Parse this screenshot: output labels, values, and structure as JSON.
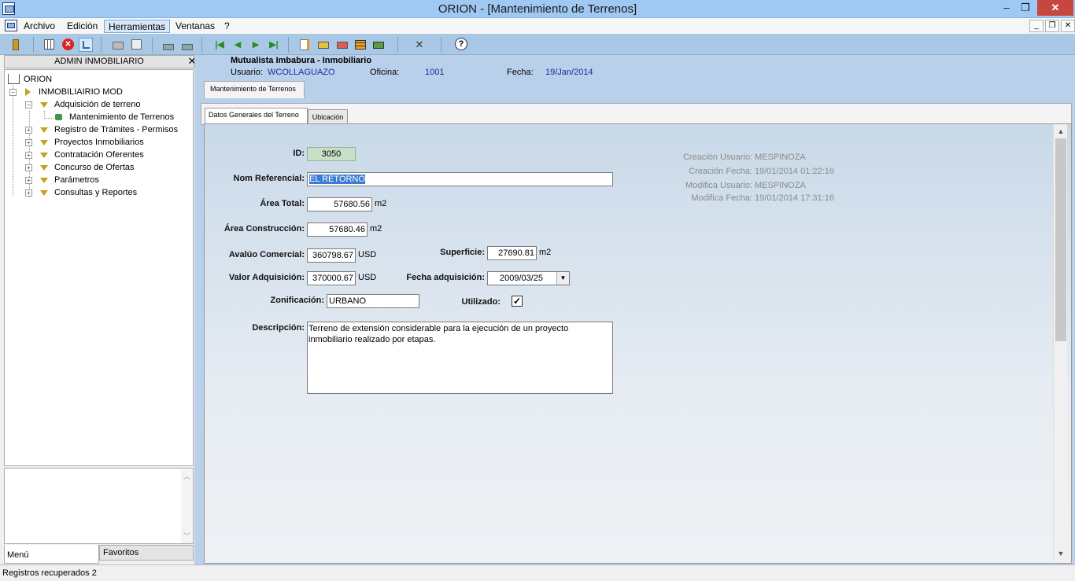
{
  "window": {
    "title": "ORION - [Mantenimiento de Terrenos]",
    "minimize": "–",
    "restore": "❐",
    "close": "✕"
  },
  "menu": {
    "items": [
      "Archivo",
      "Edición",
      "Herramientas",
      "Ventanas",
      "?"
    ],
    "mdi_min": "_",
    "mdi_restore": "❐",
    "mdi_close": "✕"
  },
  "toolbar": {
    "close_label": "✕",
    "help_label": "?"
  },
  "left_panel": {
    "header": "ADMIN INMOBILIARIO",
    "close": "✕",
    "tree": {
      "root": "ORION",
      "module": "INMOBILIAIRIO MOD",
      "items": [
        "Adquisición de terreno",
        "Mantenimiento de Terrenos",
        "Registro de Trámites - Permisos",
        "Proyectos Inmobiliarios",
        "Contratación Oferentes",
        "Concurso de Ofertas",
        "Parámetros",
        "Consultas y Reportes"
      ]
    },
    "tabs": [
      "Menú",
      "Favoritos"
    ]
  },
  "info": {
    "company": "Mutualista Imbabura - Inmobiliario",
    "usuario_label": "Usuario:",
    "usuario": "WCOLLAGUAZO",
    "oficina_label": "Oficina:",
    "oficina": "1001",
    "fecha_label": "Fecha:",
    "fecha": "19/Jan/2014"
  },
  "main_tab": "Mantenimiento de Terrenos",
  "sub_tabs": [
    "Datos Generales del Terreno",
    "Ubicación"
  ],
  "form": {
    "id_label": "ID:",
    "id": "3050",
    "nom_label": "Nom Referencial:",
    "nom": "EL RETORNO",
    "area_total_label": "Área Total:",
    "area_total": "57680.56",
    "area_total_unit": "m2",
    "area_const_label": "Área Construcción:",
    "area_const": "57680.46",
    "area_const_unit": "m2",
    "avaluo_label": "Avalúo Comercial:",
    "avaluo": "360798.67",
    "avaluo_unit": "USD",
    "superficie_label": "Superficie:",
    "superficie": "27690.81",
    "superficie_unit": "m2",
    "valor_label": "Valor Adquisición:",
    "valor": "370000.67",
    "valor_unit": "USD",
    "fecha_adq_label": "Fecha adquisición:",
    "fecha_adq": "2009/03/25",
    "zonificacion_label": "Zonificación:",
    "zonificacion": "URBANO",
    "utilizado_label": "Utilizado:",
    "utilizado_check": "✓",
    "descripcion_label": "Descripción:",
    "descripcion": "Terreno de extensión considerable para la ejecución de un proyecto inmobiliario realizado por etapas."
  },
  "audit": {
    "creacion_usuario_label": "Creación Usuario:",
    "creacion_usuario": "MESPINOZA",
    "creacion_fecha_label": "Creación Fecha:",
    "creacion_fecha": "19/01/2014 01:22:16",
    "modifica_usuario_label": "Modifica Usuario:",
    "modifica_usuario": "MESPINOZA",
    "modifica_fecha_label": "Modifica Fecha:",
    "modifica_fecha": "19/01/2014 17:31:16"
  },
  "status": {
    "text": "Registros recuperados  2"
  },
  "colors": {
    "titlebar": "#9fc8f2",
    "toolbar": "#a9c8e6",
    "panel": "#b8d0ea",
    "close": "#c7463e"
  }
}
